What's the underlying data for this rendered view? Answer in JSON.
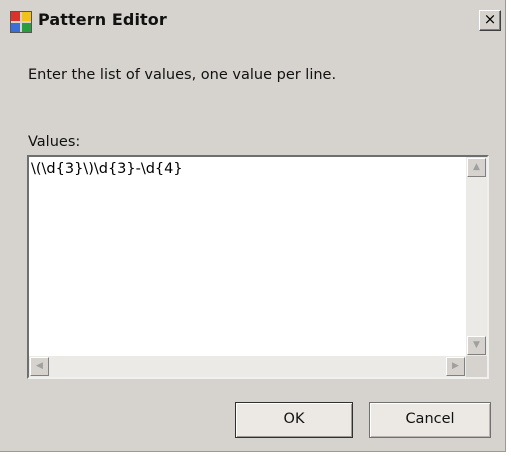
{
  "window": {
    "title": "Pattern Editor",
    "close_glyph": "×"
  },
  "content": {
    "instruction": "Enter the list of values, one value per line.",
    "values_label": "Values:",
    "values_text": "\\(\\d{3}\\)\\d{3}-\\d{4}"
  },
  "buttons": {
    "ok_label": "OK",
    "cancel_label": "Cancel"
  },
  "scrollbar": {
    "up_glyph": "▲",
    "down_glyph": "▼",
    "left_glyph": "◀",
    "right_glyph": "▶"
  }
}
